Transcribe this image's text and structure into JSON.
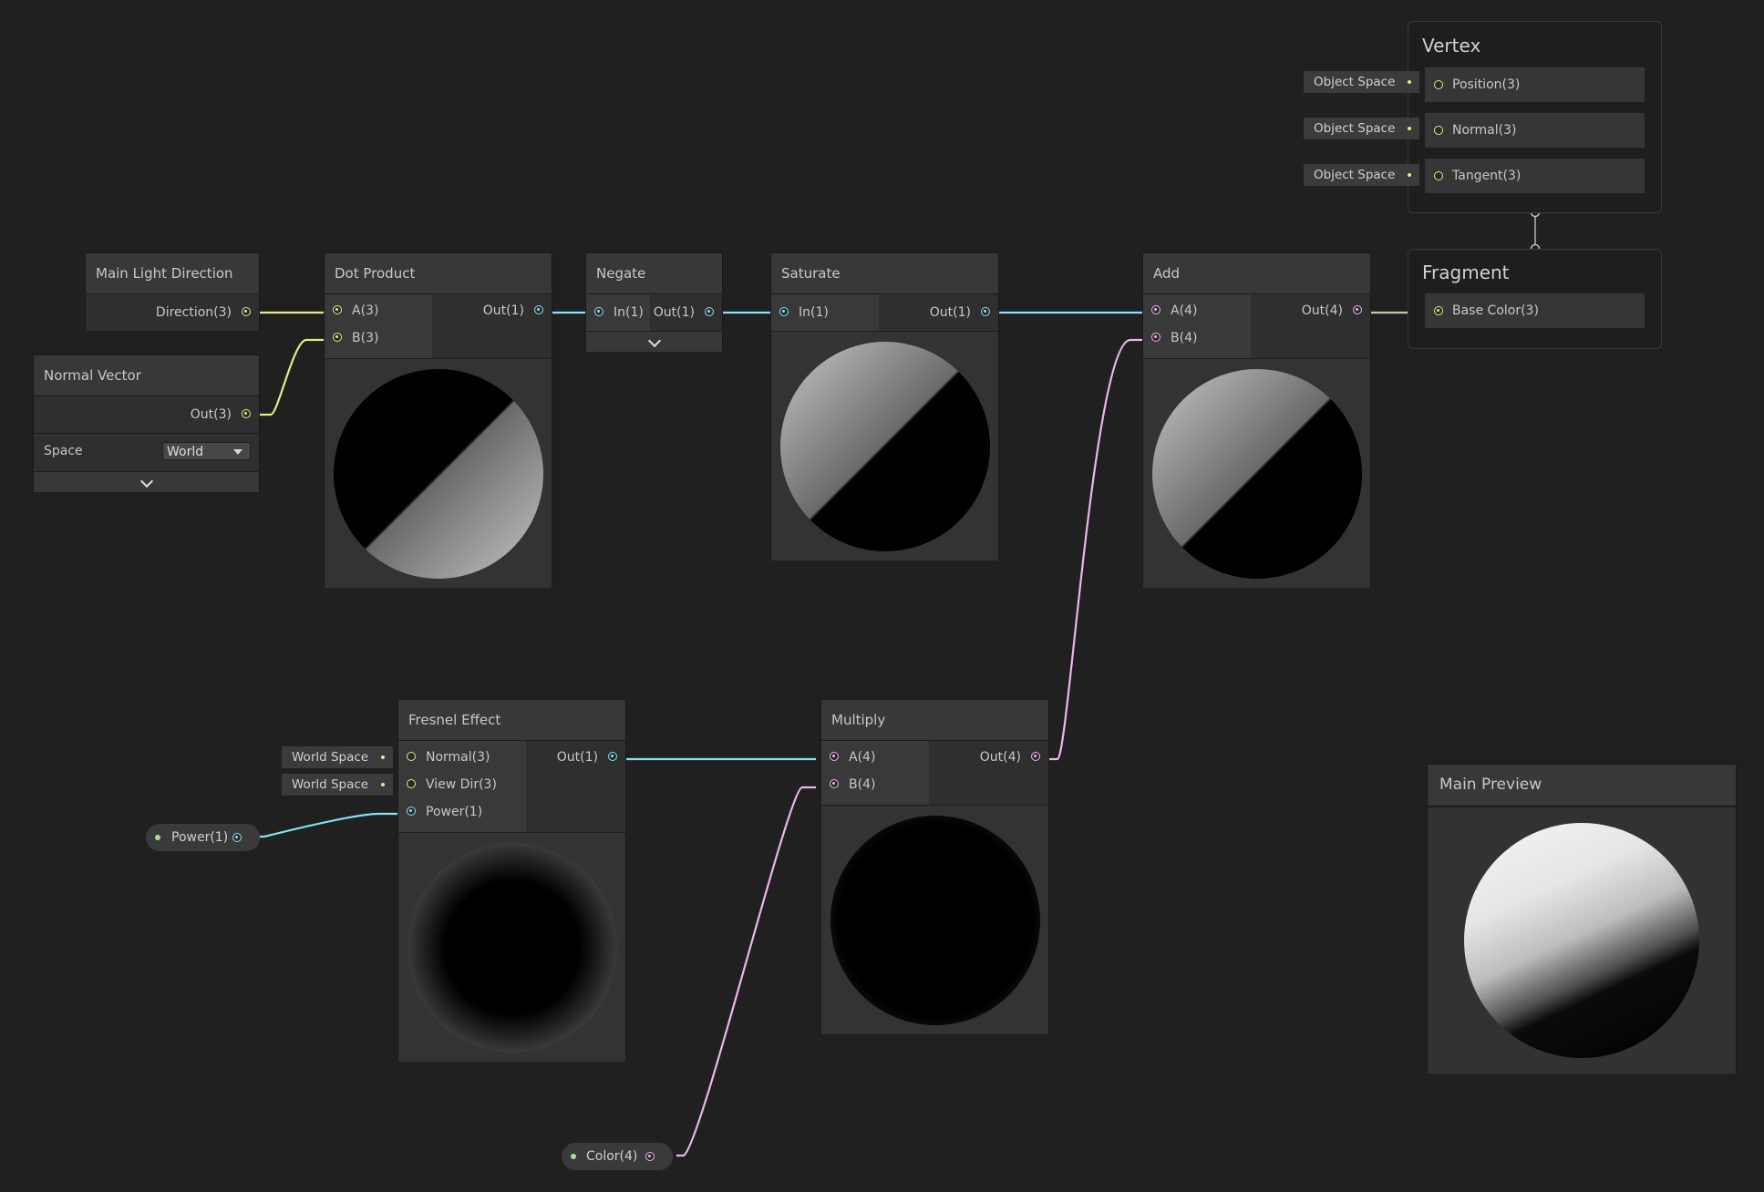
{
  "nodes": {
    "main_light": {
      "title": "Main Light Direction",
      "out": "Direction(3)"
    },
    "normal_vector": {
      "title": "Normal Vector",
      "out": "Out(3)",
      "space_label": "Space",
      "space_value": "World"
    },
    "dot_product": {
      "title": "Dot Product",
      "in_a": "A(3)",
      "in_b": "B(3)",
      "out": "Out(1)"
    },
    "negate": {
      "title": "Negate",
      "in": "In(1)",
      "out": "Out(1)"
    },
    "saturate": {
      "title": "Saturate",
      "in": "In(1)",
      "out": "Out(1)"
    },
    "add": {
      "title": "Add",
      "in_a": "A(4)",
      "in_b": "B(4)",
      "out": "Out(4)"
    },
    "fresnel": {
      "title": "Fresnel Effect",
      "in_normal": "Normal(3)",
      "in_view": "View Dir(3)",
      "in_power": "Power(1)",
      "out": "Out(1)"
    },
    "multiply": {
      "title": "Multiply",
      "in_a": "A(4)",
      "in_b": "B(4)",
      "out": "Out(4)"
    },
    "main_preview": {
      "title": "Main Preview"
    }
  },
  "vertex": {
    "title": "Vertex",
    "ports": [
      "Position(3)",
      "Normal(3)",
      "Tangent(3)"
    ],
    "tags": [
      "Object Space",
      "Object Space",
      "Object Space"
    ]
  },
  "fragment": {
    "title": "Fragment",
    "port": "Base Color(3)"
  },
  "fresnel_tags": [
    "World Space",
    "World Space"
  ],
  "properties": {
    "power": "Power(1)",
    "color": "Color(4)"
  },
  "colors": {
    "float": "#84e4f6",
    "vector3": "#e8e88a",
    "vector4": "#f0b4ee",
    "property": "#a8e28a",
    "background": "#202020"
  }
}
